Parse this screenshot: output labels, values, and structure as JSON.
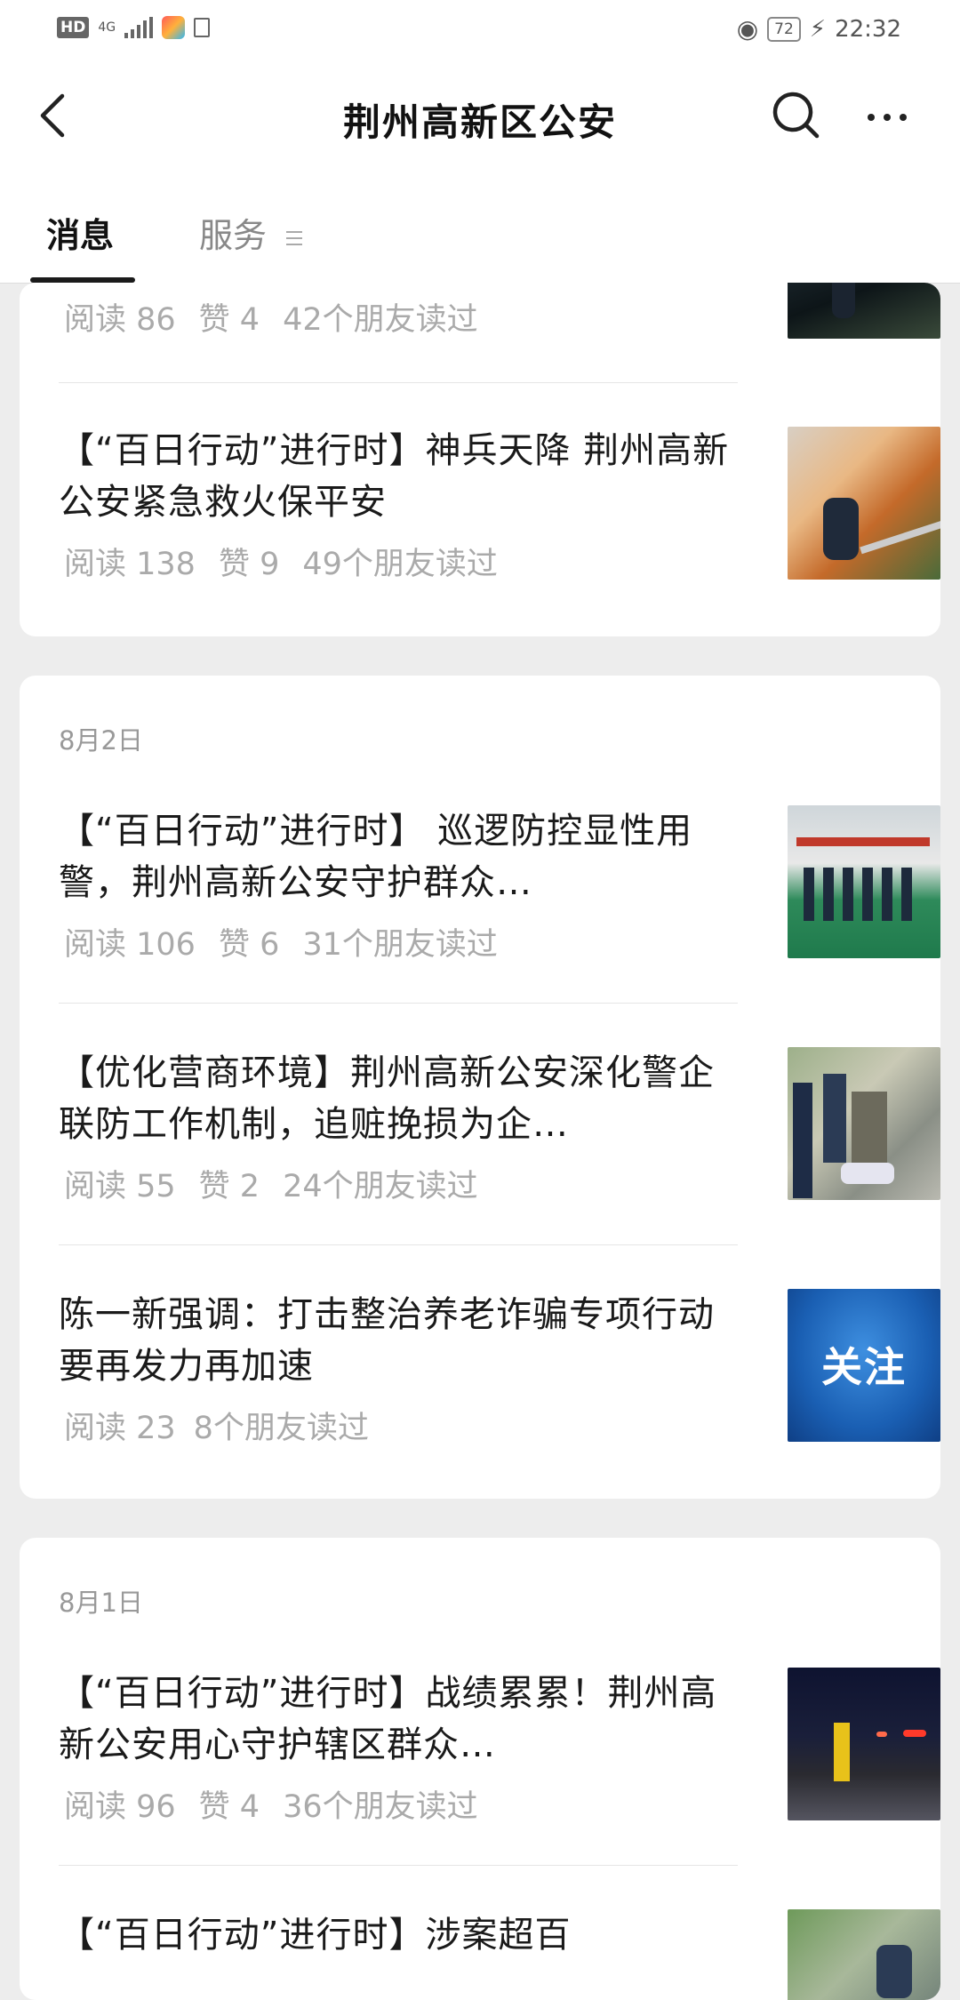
{
  "status_bar": {
    "hd": "HD",
    "network": "4G",
    "battery": "72",
    "time": "22:32"
  },
  "nav": {
    "title": "荆州高新区公安",
    "back_icon": "chevron-left-icon",
    "search_icon": "search-icon",
    "more_icon": "more-icon"
  },
  "tabs": {
    "messages": "消息",
    "services": "服务"
  },
  "groups": [
    {
      "date": "",
      "articles": [
        {
          "title": "",
          "reads": "阅读 86",
          "likes": "赞 4",
          "friends": "42个朋友读过"
        },
        {
          "title": "【“百日行动”进行时】神兵天降 荆州高新公安紧急救火保平安",
          "reads": "阅读 138",
          "likes": "赞 9",
          "friends": "49个朋友读过"
        }
      ]
    },
    {
      "date": "8月2日",
      "articles": [
        {
          "title": "【“百日行动”进行时】 巡逻防控显性用警，荆州高新公安守护群众…",
          "reads": "阅读 106",
          "likes": "赞 6",
          "friends": "31个朋友读过"
        },
        {
          "title": "【优化营商环境】荆州高新公安深化警企联防工作机制，追赃挽损为企…",
          "reads": "阅读 55",
          "likes": "赞 2",
          "friends": "24个朋友读过"
        },
        {
          "title": "陈一新强调：打击整治养老诈骗专项行动要再发力再加速",
          "reads": "阅读 23",
          "likes": "",
          "friends": "8个朋友读过",
          "thumb_text": "关注"
        }
      ]
    },
    {
      "date": "8月1日",
      "articles": [
        {
          "title": "【“百日行动”进行时】战绩累累！荆州高新公安用心守护辖区群众…",
          "reads": "阅读 96",
          "likes": "赞 4",
          "friends": "36个朋友读过"
        },
        {
          "title": "【“百日行动”进行时】涉案超百",
          "reads": "",
          "likes": "",
          "friends": ""
        }
      ]
    }
  ]
}
